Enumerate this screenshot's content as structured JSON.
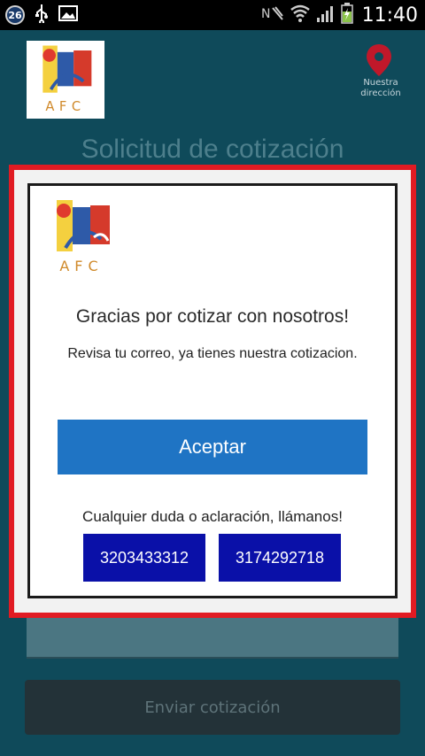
{
  "status_bar": {
    "notification_count": "26",
    "time": "11:40"
  },
  "background_app": {
    "logo_text": "AFC",
    "location_label": "Nuestra dirección",
    "page_title": "Solicitud de cotización",
    "submit_label": "Enviar cotización"
  },
  "dialog": {
    "logo_text": "AFC",
    "title": "Gracias por cotizar con nosotros!",
    "message": "Revisa tu correo, ya tienes nuestra cotizacion.",
    "accept_label": "Aceptar",
    "doubt_text": "Cualquier duda o aclaración, llámanos!",
    "phones": [
      "3203433312",
      "3174292718"
    ]
  },
  "colors": {
    "dialog_outline": "#e11b23",
    "accept_button": "#1f74c4",
    "phone_button": "#0a10a8",
    "background": "#0f4a5a"
  }
}
